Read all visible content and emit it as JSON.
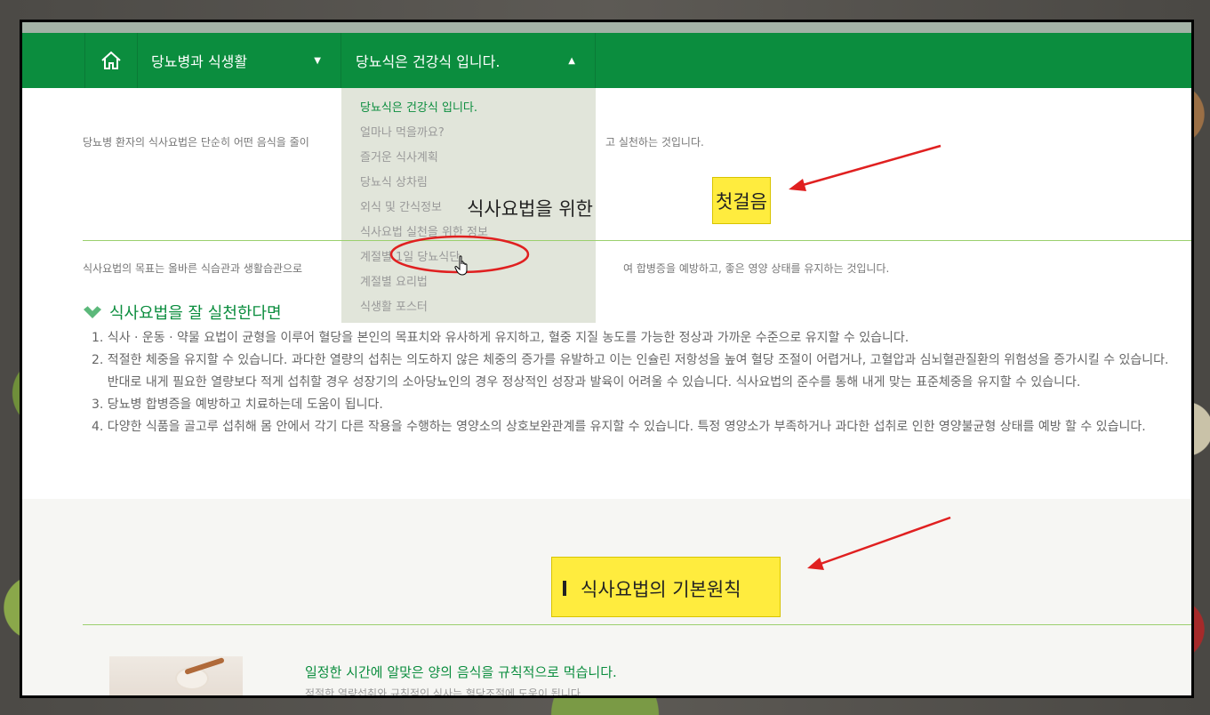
{
  "nav": {
    "home_icon": "home-icon",
    "item1": "당뇨병과 식생활",
    "item2": "당뇨식은 건강식 입니다."
  },
  "dropdown": {
    "items": [
      "당뇨식은 건강식 입니다.",
      "얼마나 먹을까요?",
      "즐거운 식사계획",
      "당뇨식 상차림",
      "외식 및 간식정보",
      "식사요법 실천을 위한 정보",
      "계절별 1일 당뇨식단",
      "계절별 요리법",
      "식생활 포스터"
    ]
  },
  "intro": {
    "left": "당뇨병 환자의 식사요법은 단순히 어떤 음식을 줄이",
    "right": "고 실천하는 것입니다."
  },
  "section1": {
    "title": "식사요법을 위한",
    "highlight": "첫걸음"
  },
  "goal": {
    "left": "식사요법의 목표는 올바른 식습관과 생활습관으로",
    "right": "여 합병증을 예방하고, 좋은 영양 상태를 유지하는 것입니다."
  },
  "practice": {
    "title": "식사요법을 잘 실천한다면",
    "items": [
      "1. 식사 · 운동 · 약물 요법이 균형을 이루어 혈당을 본인의 목표치와 유사하게 유지하고, 혈중 지질 농도를 가능한 정상과 가까운 수준으로 유지할 수 있습니다.",
      "2. 적절한 체중을 유지할 수 있습니다. 과다한 열량의 섭취는 의도하지 않은 체중의 증가를 유발하고 이는 인슐린 저항성을 높여 혈당 조절이 어렵거나, 고혈압과 심뇌혈관질환의 위험성을 증가시킬 수 있습니다.",
      "    반대로 내게 필요한 열량보다 적게 섭취할 경우 성장기의 소아당뇨인의 경우 정상적인 성장과 발육이 어려울 수 있습니다. 식사요법의 준수를 통해 내게 맞는 표준체중을 유지할 수 있습니다.",
      "3. 당뇨병 합병증을 예방하고 치료하는데 도움이 됩니다.",
      "4. 다양한 식품을 골고루 섭취해 몸 안에서 각기 다른 작용을 수행하는 영양소의 상호보완관계를 유지할 수 있습니다. 특정 영양소가 부족하거나 과다한 섭취로 인한 영양불균형 상태를 예방 할 수 있습니다."
    ]
  },
  "section2": {
    "title": "식사요법의 기본원칙"
  },
  "principle1": {
    "title": "일정한 시간에 알맞은 양의 음식을 규칙적으로 먹습니다.",
    "sub": "적절한 열량섭취와 규칙적인 식사는 혈당조절에 도움이 됩니다."
  },
  "colors": {
    "nav_green": "#0b8d3e",
    "highlight": "#ffec3e",
    "annotation_red": "#e02020"
  }
}
